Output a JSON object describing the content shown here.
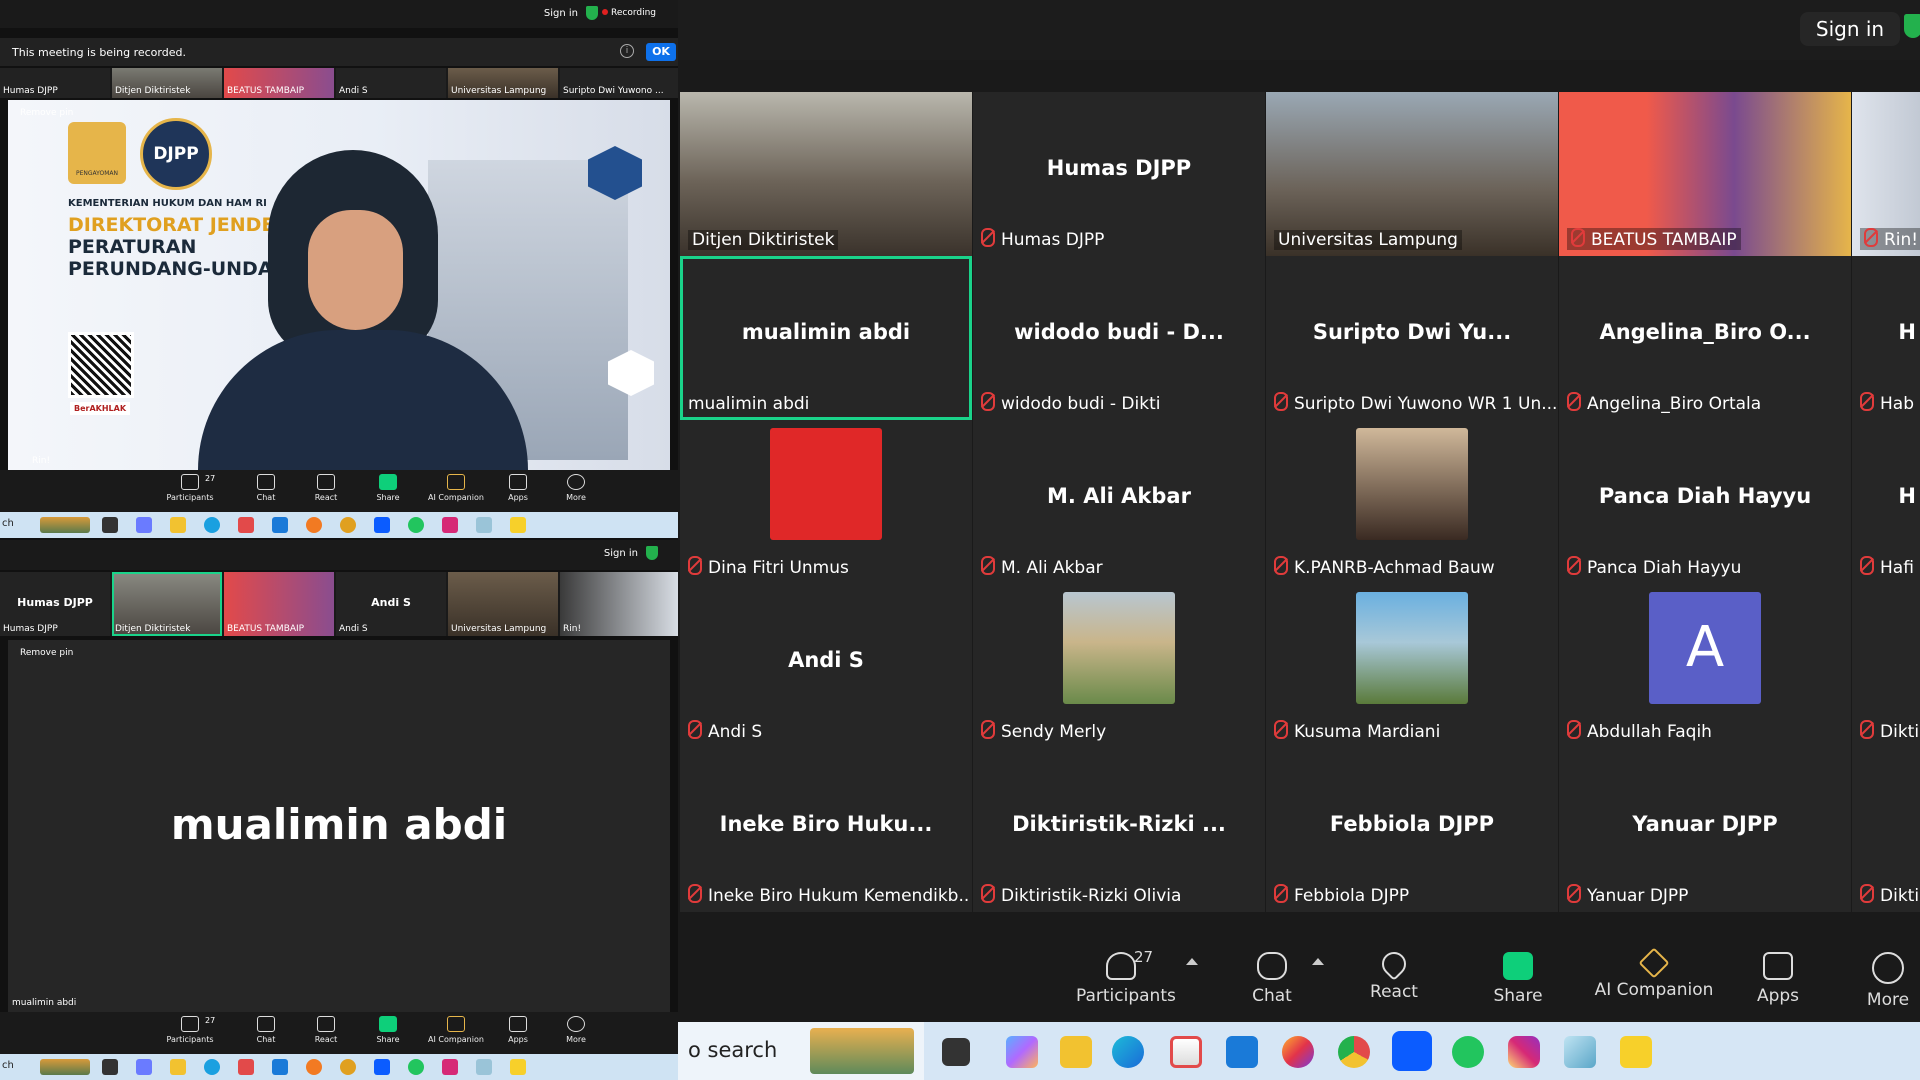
{
  "top_window": {
    "signin": "Sign in",
    "recording": "Recording",
    "recording_notice": "This meeting is being recorded.",
    "ok": "OK",
    "strip": [
      "Humas DJPP",
      "Ditjen Diktiristek",
      "BEATUS TAMBAIP",
      "Andi S",
      "Universitas Lampung",
      "Suripto Dwi Yuwono ..."
    ],
    "remove_pin": "Remove pin",
    "pinned_name": "Rin!",
    "slide": {
      "logo_left": "PENGAYOMAN",
      "logo_right": "DJPP",
      "ministry": "KEMENTERIAN HUKUM DAN HAM RI",
      "line1": "DIREKTORAT JENDERAL",
      "line2": "PERATURAN",
      "line3": "PERUNDANG-UNDANGAN",
      "badge": "BerAKHLAK"
    }
  },
  "bottom_window": {
    "signin": "Sign in",
    "strip_center": [
      "Humas DJPP",
      "Andi S"
    ],
    "strip": [
      "Humas DJPP",
      "Ditjen Diktiristek",
      "BEATUS TAMBAIP",
      "Andi S",
      "Universitas Lampung",
      "Rin!"
    ],
    "remove_pin": "Remove pin",
    "pinned_big": "mualimin abdi",
    "pinned_name": "mualimin abdi"
  },
  "small_toolbar": [
    "Participants",
    "Chat",
    "React",
    "Share",
    "AI Companion",
    "Apps",
    "More"
  ],
  "small_participants_count": "27",
  "small_search": "ch",
  "main": {
    "signin": "Sign in",
    "tiles": [
      {
        "center": "",
        "name": "Ditjen Diktiristek",
        "kind": "video-room",
        "muted": false
      },
      {
        "center": "Humas DJPP",
        "name": "Humas DJPP",
        "kind": "name",
        "muted": true
      },
      {
        "center": "",
        "name": "Universitas Lampung",
        "kind": "video-room2",
        "muted": false
      },
      {
        "center": "",
        "name": "BEATUS TAMBAIP",
        "kind": "video-man",
        "muted": true
      },
      {
        "center": "",
        "name": "Rin!",
        "kind": "video-slide",
        "muted": true
      },
      {
        "center": "mualimin abdi",
        "name": "mualimin abdi",
        "kind": "name",
        "muted": false,
        "active": true
      },
      {
        "center": "widodo budi - D...",
        "name": "widodo budi - Dikti",
        "kind": "name",
        "muted": true
      },
      {
        "center": "Suripto Dwi Yu...",
        "name": "Suripto Dwi Yuwono WR 1 Un...",
        "kind": "name",
        "muted": true
      },
      {
        "center": "Angelina_Biro O...",
        "name": "Angelina_Biro Ortala",
        "kind": "name",
        "muted": true
      },
      {
        "center": "H",
        "name": "Hab",
        "kind": "name",
        "muted": true
      },
      {
        "center": "",
        "name": "Dina Fitri Unmus",
        "kind": "photo-red",
        "muted": true
      },
      {
        "center": "M. Ali Akbar",
        "name": "M. Ali Akbar",
        "kind": "name",
        "muted": true
      },
      {
        "center": "",
        "name": "K.PANRB-Achmad Bauw",
        "kind": "photo-suit",
        "muted": true
      },
      {
        "center": "Panca Diah Hayyu",
        "name": "Panca Diah Hayyu",
        "kind": "name",
        "muted": true
      },
      {
        "center": "H",
        "name": "Hafi",
        "kind": "name",
        "muted": true
      },
      {
        "center": "Andi S",
        "name": "Andi S",
        "kind": "name",
        "muted": true
      },
      {
        "center": "",
        "name": "Sendy Merly",
        "kind": "photo-garden",
        "muted": true
      },
      {
        "center": "",
        "name": "Kusuma Mardiani",
        "kind": "photo-sea",
        "muted": true
      },
      {
        "center": "A",
        "name": "Abdullah Faqih",
        "kind": "avatar-letter",
        "muted": true
      },
      {
        "center": "",
        "name": "Dikti",
        "kind": "name",
        "muted": true
      },
      {
        "center": "Ineke Biro Huku...",
        "name": "Ineke Biro Hukum Kemendikb...",
        "kind": "name",
        "muted": true
      },
      {
        "center": "Diktiristik-Rizki ...",
        "name": "Diktiristik-Rizki Olivia",
        "kind": "name",
        "muted": true
      },
      {
        "center": "Febbiola DJPP",
        "name": "Febbiola DJPP",
        "kind": "name",
        "muted": true
      },
      {
        "center": "Yanuar DJPP",
        "name": "Yanuar DJPP",
        "kind": "name",
        "muted": true
      },
      {
        "center": "",
        "name": "Dikti",
        "kind": "name",
        "muted": true
      }
    ],
    "toolbar": {
      "participants": "Participants",
      "participants_count": "27",
      "chat": "Chat",
      "react": "React",
      "share": "Share",
      "ai": "AI Companion",
      "apps": "Apps",
      "more": "More"
    },
    "search": "o search"
  },
  "colors": {
    "share_green": "#0ecf7a",
    "active_border": "#1ad38a",
    "muted_red": "#e03b3b",
    "ok_blue": "#0e71eb",
    "avatar_purple": "#5a5fc7"
  }
}
